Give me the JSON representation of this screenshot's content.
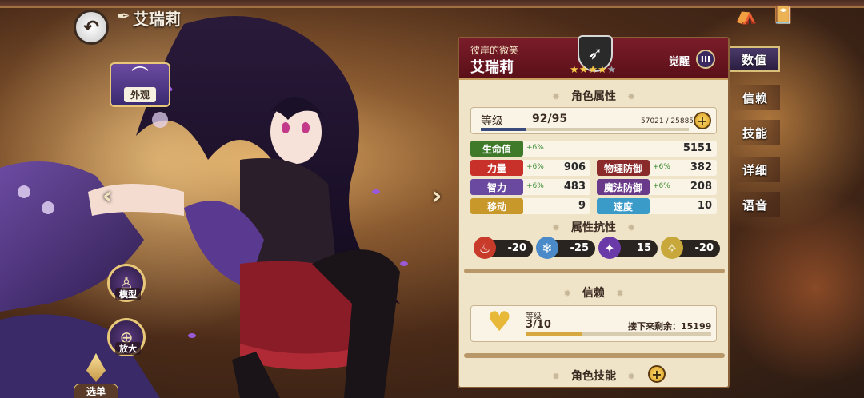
{
  "hero": {
    "name": "艾瑞莉",
    "subtitle": "彼岸的微笑",
    "stars_filled": 4,
    "stars_total": 5,
    "awaken_label": "觉醒",
    "awaken_level": "III",
    "class_icon": "bow-icon"
  },
  "left": {
    "outfit_label": "外观",
    "model_label": "模型",
    "zoom_label": "放大",
    "select_label": "选单"
  },
  "panel": {
    "attr_title": "角色属性",
    "level_label": "等级",
    "level_value": "92/95",
    "exp_value": "57021 / 258859",
    "exp_progress": 0.22,
    "stats": [
      {
        "label": "生命值",
        "bonus": "+6%",
        "value": "5151",
        "color": "#3e7a2a"
      },
      {
        "label": "力量",
        "bonus": "+6%",
        "value": "906",
        "color": "#c8302a"
      },
      {
        "label": "物理防御",
        "bonus": "+6%",
        "value": "382",
        "color": "#8a2a2a"
      },
      {
        "label": "智力",
        "bonus": "+6%",
        "value": "483",
        "color": "#6a4aa0"
      },
      {
        "label": "魔法防御",
        "bonus": "+6%",
        "value": "208",
        "color": "#6a3a8a"
      },
      {
        "label": "移动",
        "bonus": "",
        "value": "9",
        "color": "#c8982a"
      },
      {
        "label": "速度",
        "bonus": "",
        "value": "10",
        "color": "#3a9ac8"
      }
    ],
    "resist_title": "属性抗性",
    "resists": [
      {
        "icon": "fire-icon",
        "value": "-20",
        "color": "#c83a2a"
      },
      {
        "icon": "ice-icon",
        "value": "-25",
        "color": "#4a8ac8"
      },
      {
        "icon": "dark-icon",
        "value": "15",
        "color": "#6a3aa8"
      },
      {
        "icon": "light-icon",
        "value": "-20",
        "color": "#c8a83a"
      }
    ],
    "trust_title": "信赖",
    "trust_level_label": "等级",
    "trust_level_value": "3/10",
    "trust_remaining": "接下来剩余：15199",
    "trust_progress": 0.3,
    "skill_title": "角色技能"
  },
  "tabs": [
    "数值",
    "信赖",
    "技能",
    "详细",
    "语音"
  ]
}
